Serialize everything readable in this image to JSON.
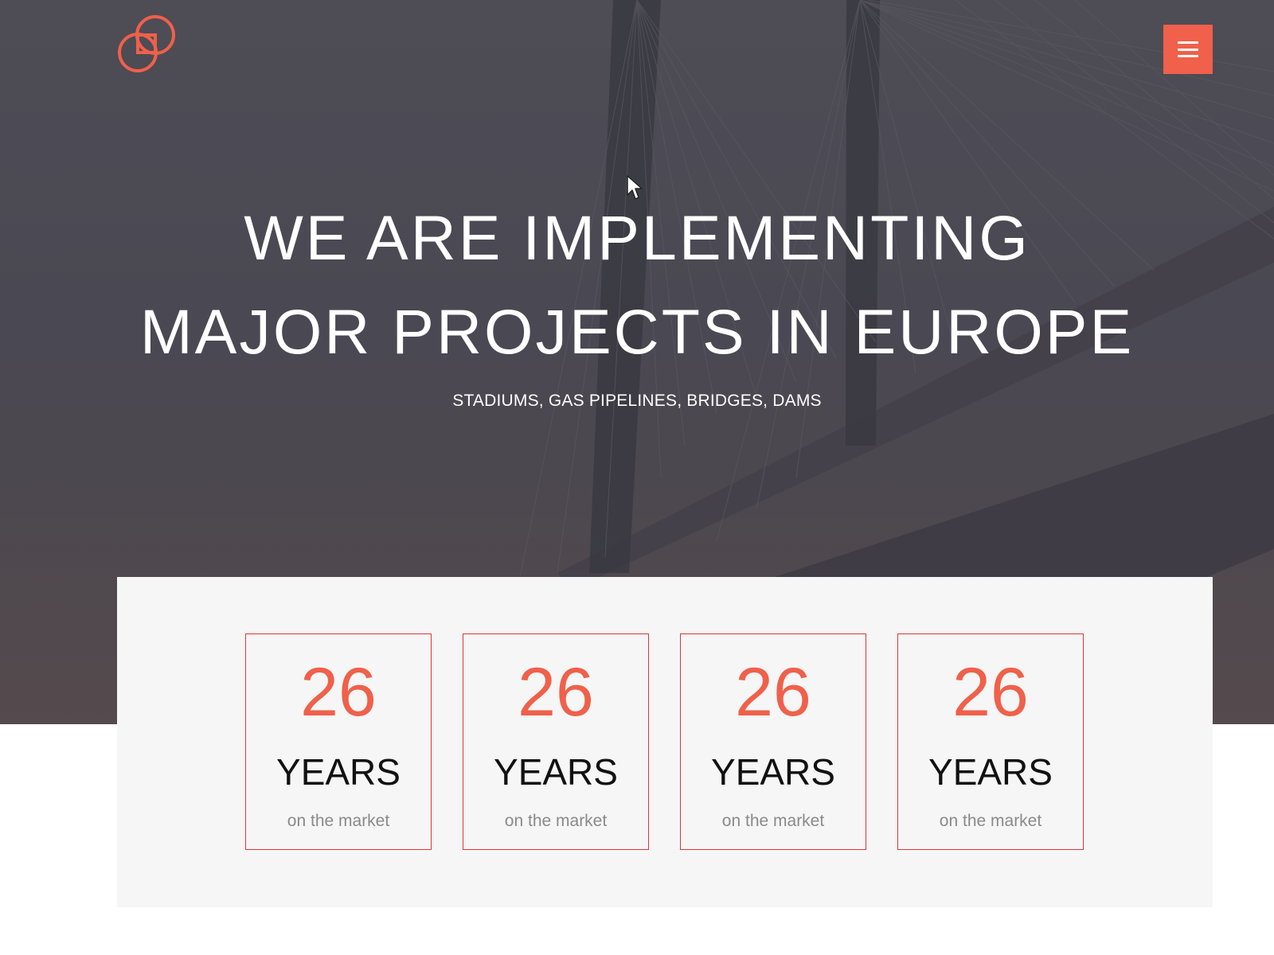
{
  "brand": {
    "logo_icon": "linked-rings-logo-icon",
    "accent_color": "#f0604a"
  },
  "header": {
    "menu_icon": "hamburger-menu-icon",
    "menu_aria_label": "Menu"
  },
  "hero": {
    "headline_line1": "WE ARE IMPLEMENTING",
    "headline_line2": "MAJOR PROJECTS IN EUROPE",
    "subtitle": "STADIUMS, GAS PIPELINES, BRIDGES, DAMS",
    "background_icon": "cable-stayed-bridge-photo"
  },
  "stats": [
    {
      "number": "26",
      "unit": "YEARS",
      "caption": "on the market"
    },
    {
      "number": "26",
      "unit": "YEARS",
      "caption": "on the market"
    },
    {
      "number": "26",
      "unit": "YEARS",
      "caption": "on the market"
    },
    {
      "number": "26",
      "unit": "YEARS",
      "caption": "on the market"
    }
  ]
}
